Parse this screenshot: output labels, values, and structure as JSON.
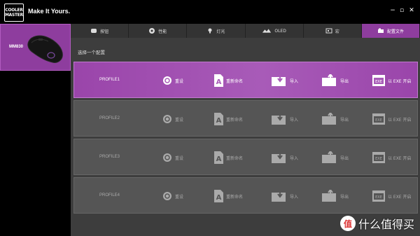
{
  "brand": {
    "logo_line1": "COOLER",
    "logo_line2": "MASTER",
    "tagline": "Make It Yours."
  },
  "window": {
    "minimize": "−",
    "maximize": "▫",
    "close": "✕"
  },
  "device": {
    "name": "MM830"
  },
  "tabs": [
    {
      "label": "按钮",
      "icon": "mouse-icon"
    },
    {
      "label": "性能",
      "icon": "gauge-icon"
    },
    {
      "label": "灯光",
      "icon": "lightbulb-icon"
    },
    {
      "label": "OLED",
      "icon": "oled-icon"
    },
    {
      "label": "宏",
      "icon": "macro-icon"
    },
    {
      "label": "配置文件",
      "icon": "profile-icon",
      "active": true
    }
  ],
  "section": {
    "label": "选择一个配置"
  },
  "actions": {
    "reset": "重设",
    "rename": "重新命名",
    "import": "导入",
    "export": "导出",
    "exe": "以 EXE 开启"
  },
  "profiles": [
    {
      "name": "PROFILE1",
      "active": true
    },
    {
      "name": "PROFILE2",
      "active": false
    },
    {
      "name": "PROFILE3",
      "active": false
    },
    {
      "name": "PROFILE4",
      "active": false
    }
  ],
  "watermark": {
    "glyph": "值",
    "text": "什么值得买"
  },
  "colors": {
    "accent": "#8e3d9e",
    "active_row": "#a85bb8",
    "panel": "#3d3d3d",
    "row": "#555555"
  }
}
